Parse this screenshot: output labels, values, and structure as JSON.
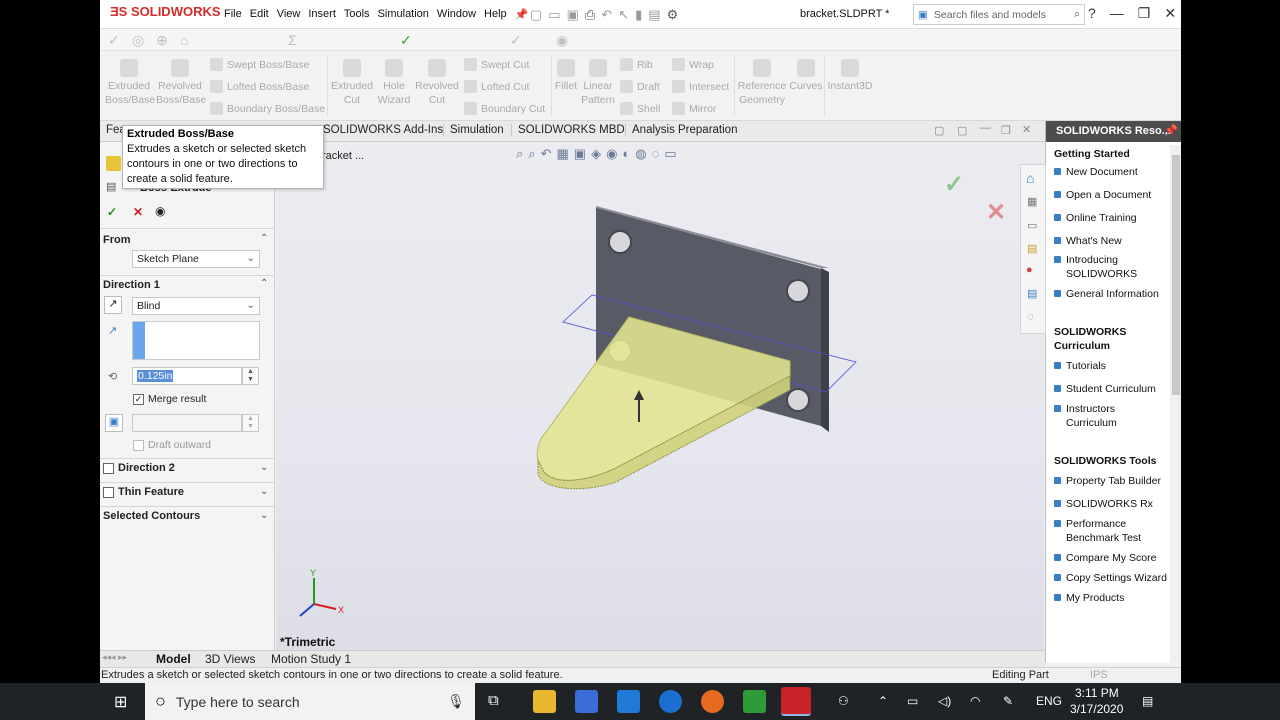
{
  "app": {
    "brand": "SOLIDWORKS",
    "document_title": "bracket.SLDPRT *",
    "search_placeholder": "Search files and models",
    "menu": [
      "File",
      "Edit",
      "View",
      "Insert",
      "Tools",
      "Simulation",
      "Window",
      "Help"
    ]
  },
  "ribbon": {
    "extruded_boss": "Extruded\nBoss/Base",
    "revolved_boss": "Revolved\nBoss/Base",
    "swept_boss": "Swept Boss/Base",
    "lofted_boss": "Lofted Boss/Base",
    "boundary_boss": "Boundary Boss/Base",
    "extruded_cut": "Extruded\nCut",
    "hole_wizard": "Hole\nWizard",
    "revolved_cut": "Revolved\nCut",
    "swept_cut": "Swept Cut",
    "lofted_cut": "Lofted Cut",
    "boundary_cut": "Boundary Cut",
    "fillet": "Fillet",
    "linear_pattern": "Linear\nPattern",
    "rib": "Rib",
    "draft": "Draft",
    "shell": "Shell",
    "wrap": "Wrap",
    "intersect": "Intersect",
    "mirror": "Mirror",
    "reference_geometry": "Reference\nGeometry",
    "curves": "Curves",
    "instant3d": "Instant3D"
  },
  "tabs": [
    "Fea",
    "SOLIDWORKS Add-Ins",
    "Simulation",
    "SOLIDWORKS MBD",
    "Analysis Preparation"
  ],
  "tooltip": {
    "title": "Extruded Boss/Base",
    "description": "Extrudes a sketch or selected sketch contours in one or two directions to create a solid feature."
  },
  "tree_label": "racket ...",
  "property_manager": {
    "title": "Boss-Extrude",
    "from_label": "From",
    "from_value": "Sketch Plane",
    "direction1_label": "Direction 1",
    "end_condition": "Blind",
    "depth": "0.125in",
    "merge_result": "Merge result",
    "draft_outward": "Draft outward",
    "direction2_label": "Direction 2",
    "thin_feature_label": "Thin Feature",
    "selected_contours_label": "Selected Contours"
  },
  "viewport": {
    "view_label": "*Trimetric"
  },
  "bottom_tabs": [
    "Model",
    "3D Views",
    "Motion Study 1"
  ],
  "status_text": "Extrudes a sketch or selected sketch contours in one or two directions to create a solid feature.",
  "status_right": "Editing Part",
  "status_units": "IPS",
  "task_pane": {
    "header": "SOLIDWORKS Reso...",
    "getting_started": "Getting Started",
    "gs_items": [
      "New Document",
      "Open a Document",
      "Online Training",
      "What's New",
      "Introducing SOLIDWORKS",
      "General Information"
    ],
    "curriculum": "SOLIDWORKS Curriculum",
    "cur_items": [
      "Tutorials",
      "Student Curriculum",
      "Instructors Curriculum"
    ],
    "tools": "SOLIDWORKS Tools",
    "tool_items": [
      "Property Tab Builder",
      "SOLIDWORKS Rx",
      "Performance Benchmark Test",
      "Compare My Score",
      "Copy Settings Wizard",
      "My Products"
    ]
  },
  "taskbar": {
    "search_placeholder": "Type here to search",
    "time": "3:11 PM",
    "date": "3/17/2020",
    "lang": "ENG"
  },
  "colors": {
    "brand_red": "#d42b2b",
    "body_gray": "#5a5d66",
    "extrude_yellow": "#e8e89a",
    "taskbar": "#1f2326"
  }
}
